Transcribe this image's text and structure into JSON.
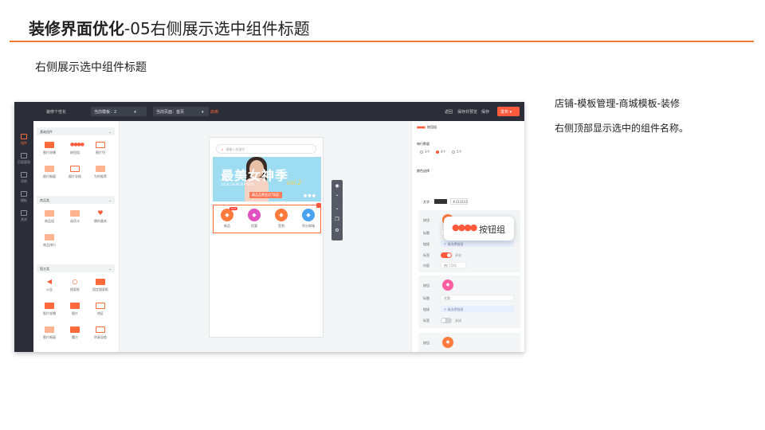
{
  "slide": {
    "title_bold": "装修界面优化",
    "title_rest": "-05右侧展示选中组件标题",
    "subtitle": "右侧展示选中组件标题",
    "note_path": "店铺-模板管理-商城模板-装修",
    "note_desc": "右侧顶部显示选中的组件名称。"
  },
  "callout": {
    "label": "按钮组",
    "icon": "dots-icon"
  },
  "shot": {
    "topbar": {
      "app_name": "装修个性化",
      "template_select": "当前模板：2",
      "page_select": "当前页面：首页",
      "badge": "启用",
      "actions": [
        "返回",
        "保存并预览",
        "保存"
      ],
      "publish": "发布"
    },
    "rail": [
      "组件",
      "页面管理",
      "导航",
      "模板",
      "其他"
    ],
    "library": {
      "groups": [
        "基础组件",
        "商品类",
        "图文类"
      ],
      "basic": [
        "图片轮播",
        "按钮组",
        "图片列",
        "图片橱窗",
        "图片导航",
        "为你推荐"
      ],
      "goods": [
        "商品组",
        "选项卡",
        "猜你喜欢",
        "商品排行"
      ],
      "media": [
        "公告",
        "搜索框",
        "固定搜索框",
        "图片轮播",
        "图片",
        "热区",
        "图片橱窗",
        "魔方",
        "列表导航"
      ]
    },
    "phone": {
      "search_placeholder": "请输入关键字",
      "banner_title": "最美女神季",
      "banner_sub": "2018 CHUN XIA NEW",
      "banner_tag": "精品品牌会员7折起",
      "banner_vol": "vol.2",
      "icons": [
        "新品",
        "优惠",
        "签到",
        "积分商城"
      ],
      "badge": "HOT"
    },
    "props": {
      "head": "按钮组",
      "per_row_label": "每行数量",
      "per_row_options": [
        "3个",
        "4个",
        "5个"
      ],
      "color_label": "颜色选择",
      "text_label": "文字",
      "hex": "#333333",
      "card1": {
        "icon_label": "按钮",
        "title_label": "标题",
        "title_value": "新品",
        "link_label": "链接",
        "link_placeholder": "请选择链接",
        "tag_label": "标签",
        "tag_state": "开启",
        "content_label": "内容",
        "content_value": "热门",
        "limit": "0/3"
      },
      "card2": {
        "icon_label": "按钮",
        "title_label": "标题",
        "title_value": "优惠",
        "link_label": "链接",
        "link_placeholder": "请选择链接",
        "tag_label": "标签",
        "tag_state": "关闭"
      },
      "card3": {
        "icon_label": "按钮"
      }
    }
  }
}
